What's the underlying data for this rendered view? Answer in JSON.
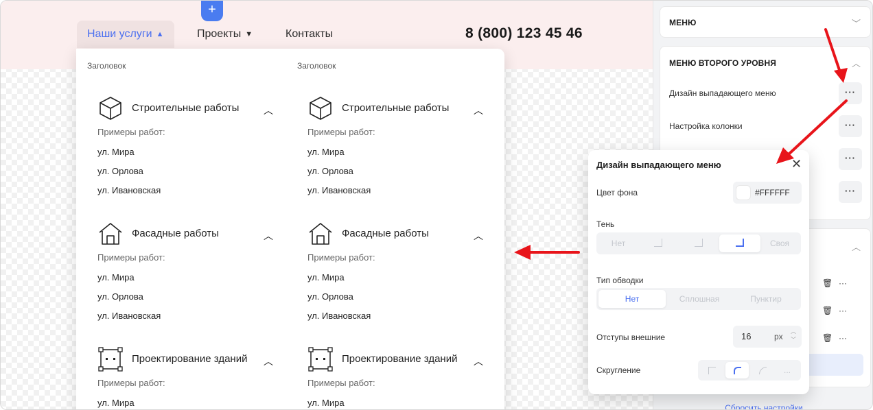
{
  "site": {
    "nav": {
      "services": "Наши услуги",
      "projects": "Проекты",
      "contacts": "Контакты"
    },
    "phone": "8 (800) 123 45 46",
    "add_block_icon": "+"
  },
  "dropdown": {
    "columns": [
      {
        "title": "Заголовок",
        "sections": [
          {
            "icon": "cube-icon",
            "title": "Строительные работы",
            "subhead": "Примеры работ:",
            "items": [
              "ул. Мира",
              "ул. Орлова",
              "ул. Ивановская"
            ]
          },
          {
            "icon": "house-icon",
            "title": "Фасадные работы",
            "subhead": "Примеры работ:",
            "items": [
              "ул. Мира",
              "ул. Орлова",
              "ул. Ивановская"
            ]
          },
          {
            "icon": "blueprint-icon",
            "title": "Проектирование зданий",
            "subhead": "Примеры работ:",
            "items": [
              "ул. Мира"
            ]
          }
        ]
      },
      {
        "title": "Заголовок",
        "sections": [
          {
            "icon": "cube-icon",
            "title": "Строительные работы",
            "subhead": "Примеры работ:",
            "items": [
              "ул. Мира",
              "ул. Орлова",
              "ул. Ивановская"
            ]
          },
          {
            "icon": "house-icon",
            "title": "Фасадные работы",
            "subhead": "Примеры работ:",
            "items": [
              "ул. Мира",
              "ул. Орлова",
              "ул. Ивановская"
            ]
          },
          {
            "icon": "blueprint-icon",
            "title": "Проектирование зданий",
            "subhead": "Примеры работ:",
            "items": [
              "ул. Мира"
            ]
          }
        ]
      }
    ]
  },
  "panel": {
    "menu_header": "МЕНЮ",
    "second_level_header": "МЕНЮ ВТОРОГО УРОВНЯ",
    "rows": [
      "Дизайн выпадающего меню",
      "Настройка колонки"
    ],
    "dots": "···",
    "reset": "Сбросить настройки"
  },
  "popup": {
    "title": "Дизайн выпадающего меню",
    "close": "✕",
    "bg_label": "Цвет фона",
    "bg_value": "#FFFFFF",
    "shadow_label": "Тень",
    "shadow_options": [
      "Нет",
      "",
      "",
      "",
      "Своя"
    ],
    "shadow_selected": 3,
    "border_label": "Тип обводки",
    "border_options": [
      "Нет",
      "Сплошная",
      "Пунктир"
    ],
    "border_selected": 0,
    "margin_label": "Отступы внешние",
    "margin_value": "16",
    "margin_unit": "px",
    "radius_label": "Скругление",
    "radius_more": "..."
  },
  "colors": {
    "accent": "#4a6ff0",
    "arrow": "#e8141a",
    "hero_bg": "#fbeeee"
  }
}
